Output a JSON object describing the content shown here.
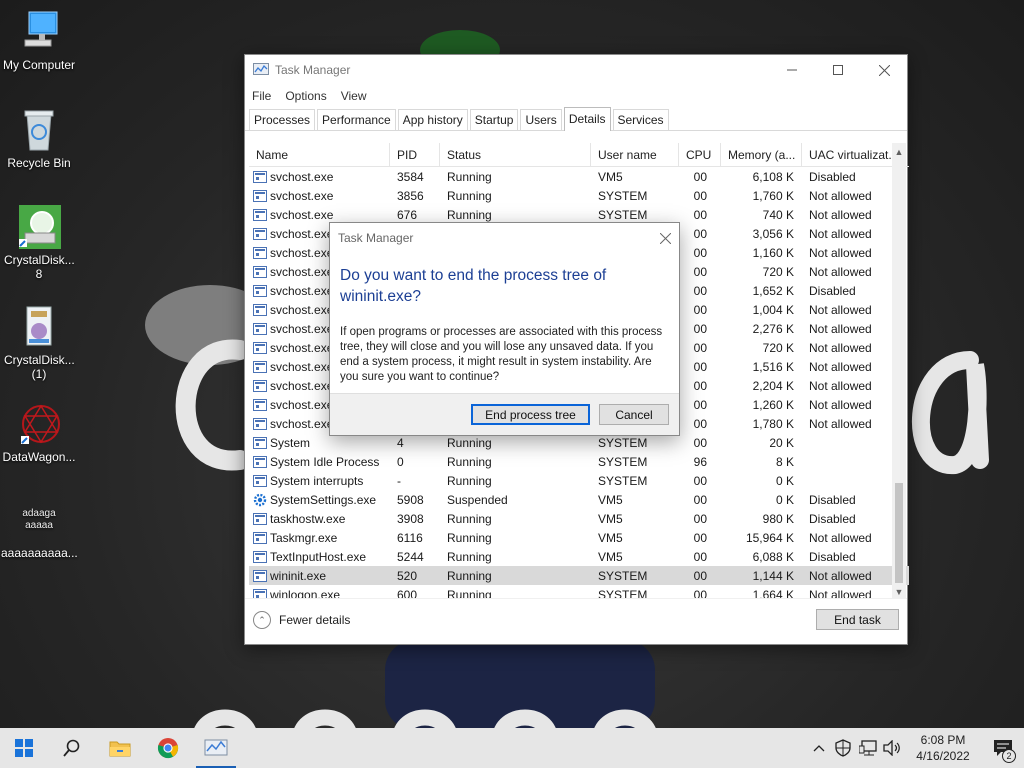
{
  "desktop": {
    "icons": [
      {
        "label": "My Computer"
      },
      {
        "label": "Recycle Bin"
      },
      {
        "label": "CrystalDisk... 8"
      },
      {
        "label": "CrystalDisk... (1)"
      },
      {
        "label": "DataWagon..."
      },
      {
        "label": "aaaaaaaaaa...",
        "subtitle_line1": "adaaga",
        "subtitle_line2": "aaaaa"
      }
    ]
  },
  "task_manager": {
    "title": "Task Manager",
    "menu": [
      "File",
      "Options",
      "View"
    ],
    "tabs": [
      "Processes",
      "Performance",
      "App history",
      "Startup",
      "Users",
      "Details",
      "Services"
    ],
    "active_tab": "Details",
    "columns": [
      "Name",
      "PID",
      "Status",
      "User name",
      "CPU",
      "Memory (a...",
      "UAC virtualizat..."
    ],
    "rows": [
      {
        "name": "svchost.exe",
        "pid": "3584",
        "status": "Running",
        "user": "VM5",
        "cpu": "00",
        "mem": "6,108 K",
        "uac": "Disabled"
      },
      {
        "name": "svchost.exe",
        "pid": "3856",
        "status": "Running",
        "user": "SYSTEM",
        "cpu": "00",
        "mem": "1,760 K",
        "uac": "Not allowed"
      },
      {
        "name": "svchost.exe",
        "pid": "676",
        "status": "Running",
        "user": "SYSTEM",
        "cpu": "00",
        "mem": "740 K",
        "uac": "Not allowed"
      },
      {
        "name": "svchost.exe",
        "pid": "",
        "status": "",
        "user": "",
        "cpu": "00",
        "mem": "3,056 K",
        "uac": "Not allowed"
      },
      {
        "name": "svchost.exe",
        "pid": "",
        "status": "",
        "user": "",
        "cpu": "00",
        "mem": "1,160 K",
        "uac": "Not allowed"
      },
      {
        "name": "svchost.exe",
        "pid": "",
        "status": "",
        "user": "",
        "cpu": "00",
        "mem": "720 K",
        "uac": "Not allowed"
      },
      {
        "name": "svchost.exe",
        "pid": "",
        "status": "",
        "user": "",
        "cpu": "00",
        "mem": "1,652 K",
        "uac": "Disabled"
      },
      {
        "name": "svchost.exe",
        "pid": "",
        "status": "",
        "user": "",
        "cpu": "00",
        "mem": "1,004 K",
        "uac": "Not allowed"
      },
      {
        "name": "svchost.exe",
        "pid": "",
        "status": "",
        "user": "",
        "cpu": "00",
        "mem": "2,276 K",
        "uac": "Not allowed"
      },
      {
        "name": "svchost.exe",
        "pid": "",
        "status": "",
        "user": "",
        "cpu": "00",
        "mem": "720 K",
        "uac": "Not allowed"
      },
      {
        "name": "svchost.exe",
        "pid": "",
        "status": "",
        "user": "",
        "cpu": "00",
        "mem": "1,516 K",
        "uac": "Not allowed"
      },
      {
        "name": "svchost.exe",
        "pid": "",
        "status": "",
        "user": "",
        "cpu": "00",
        "mem": "2,204 K",
        "uac": "Not allowed"
      },
      {
        "name": "svchost.exe",
        "pid": "",
        "status": "",
        "user": "",
        "cpu": "00",
        "mem": "1,260 K",
        "uac": "Not allowed"
      },
      {
        "name": "svchost.exe",
        "pid": "",
        "status": "",
        "user": "",
        "cpu": "00",
        "mem": "1,780 K",
        "uac": "Not allowed"
      },
      {
        "name": "System",
        "pid": "4",
        "status": "Running",
        "user": "SYSTEM",
        "cpu": "00",
        "mem": "20 K",
        "uac": ""
      },
      {
        "name": "System Idle Process",
        "pid": "0",
        "status": "Running",
        "user": "SYSTEM",
        "cpu": "96",
        "mem": "8 K",
        "uac": ""
      },
      {
        "name": "System interrupts",
        "pid": "-",
        "status": "Running",
        "user": "SYSTEM",
        "cpu": "00",
        "mem": "0 K",
        "uac": ""
      },
      {
        "name": "SystemSettings.exe",
        "pid": "5908",
        "status": "Suspended",
        "user": "VM5",
        "cpu": "00",
        "mem": "0 K",
        "uac": "Disabled",
        "icon": "gear"
      },
      {
        "name": "taskhostw.exe",
        "pid": "3908",
        "status": "Running",
        "user": "VM5",
        "cpu": "00",
        "mem": "980 K",
        "uac": "Disabled"
      },
      {
        "name": "Taskmgr.exe",
        "pid": "6116",
        "status": "Running",
        "user": "VM5",
        "cpu": "00",
        "mem": "15,964 K",
        "uac": "Not allowed"
      },
      {
        "name": "TextInputHost.exe",
        "pid": "5244",
        "status": "Running",
        "user": "VM5",
        "cpu": "00",
        "mem": "6,088 K",
        "uac": "Disabled"
      },
      {
        "name": "wininit.exe",
        "pid": "520",
        "status": "Running",
        "user": "SYSTEM",
        "cpu": "00",
        "mem": "1,144 K",
        "uac": "Not allowed",
        "selected": true
      },
      {
        "name": "winlogon.exe",
        "pid": "600",
        "status": "Running",
        "user": "SYSTEM",
        "cpu": "00",
        "mem": "1,664 K",
        "uac": "Not allowed"
      }
    ],
    "footer": {
      "fewer_details": "Fewer details",
      "end_task": "End task"
    }
  },
  "dialog": {
    "title": "Task Manager",
    "heading": "Do you want to end the process tree of wininit.exe?",
    "body": "If open programs or processes are associated with this process tree, they will close and you will lose any unsaved data. If you end a system process, it might result in system instability. Are you sure you want to continue?",
    "primary_button": "End process tree",
    "cancel_button": "Cancel"
  },
  "taskbar": {
    "items": [
      "start-icon",
      "search-icon",
      "file-explorer-icon",
      "chrome-icon",
      "task-manager-icon"
    ],
    "active_item": "task-manager-icon",
    "time": "6:08 PM",
    "date": "4/16/2022",
    "notification_count": "2"
  },
  "colors": {
    "dialog_heading": "#1c3f94",
    "primary_button_border": "#0a64d8",
    "selected_row": "#d9d9d9",
    "taskbar_bg": "#e6e6e6"
  }
}
